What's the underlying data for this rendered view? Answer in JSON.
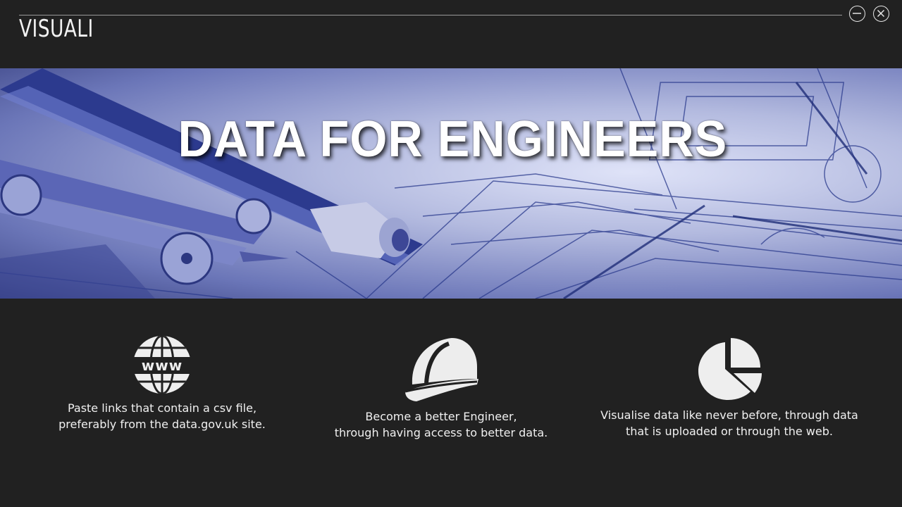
{
  "app": {
    "title": "VISUALI"
  },
  "window_controls": {
    "minimize_icon": "minimize-circle-icon",
    "close_icon": "close-circle-icon"
  },
  "hero": {
    "title": "DATA FOR ENGINEERS"
  },
  "features": [
    {
      "icon": "globe-www-icon",
      "line1": "Paste links that contain a csv file,",
      "line2": "preferably from the data.gov.uk site."
    },
    {
      "icon": "hard-hat-icon",
      "line1": "Become a better Engineer,",
      "line2": "through having access to better data."
    },
    {
      "icon": "pie-chart-icon",
      "line1": "Visualise data like never before, through data",
      "line2": "that is uploaded or through the web."
    }
  ]
}
